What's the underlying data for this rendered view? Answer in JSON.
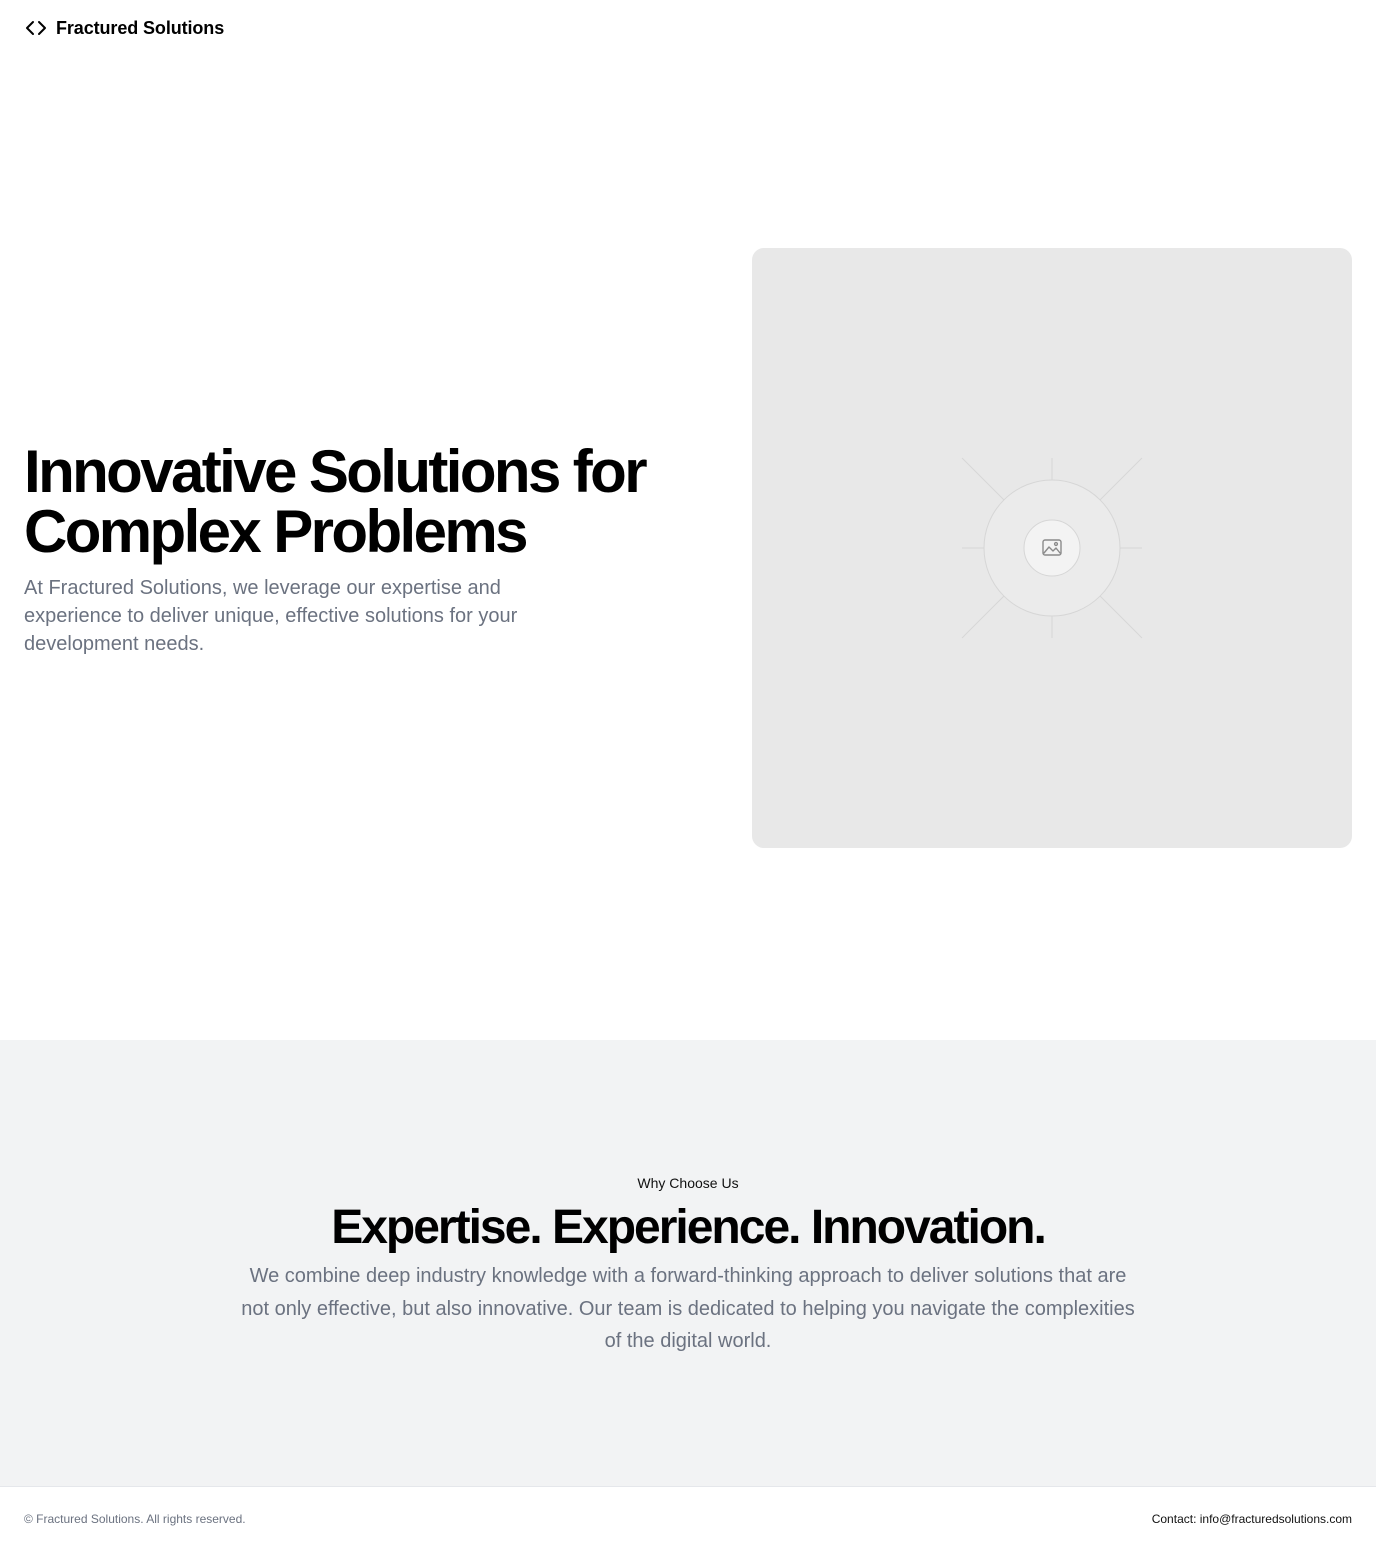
{
  "header": {
    "brand_name": "Fractured Solutions",
    "brand_icon": "code-brackets-icon"
  },
  "hero": {
    "title": "Innovative Solutions for Complex Problems",
    "subtitle": "At Fractured Solutions, we leverage our expertise and experience to deliver unique, effective solutions for your development needs.",
    "image_icon": "image-placeholder-icon"
  },
  "why": {
    "eyebrow": "Why Choose Us",
    "title": "Expertise. Experience. Innovation.",
    "text": "We combine deep industry knowledge with a forward-thinking approach to deliver solutions that are not only effective, but also innovative. Our team is dedicated to helping you navigate the complexities of the digital world."
  },
  "footer": {
    "copyright": "© Fractured Solutions. All rights reserved.",
    "contact": "Contact: info@fracturedsolutions.com"
  },
  "colors": {
    "text_primary": "#000000",
    "text_muted": "#6b7280",
    "section_bg": "#f2f3f4",
    "placeholder_bg": "#e8e8e8"
  }
}
